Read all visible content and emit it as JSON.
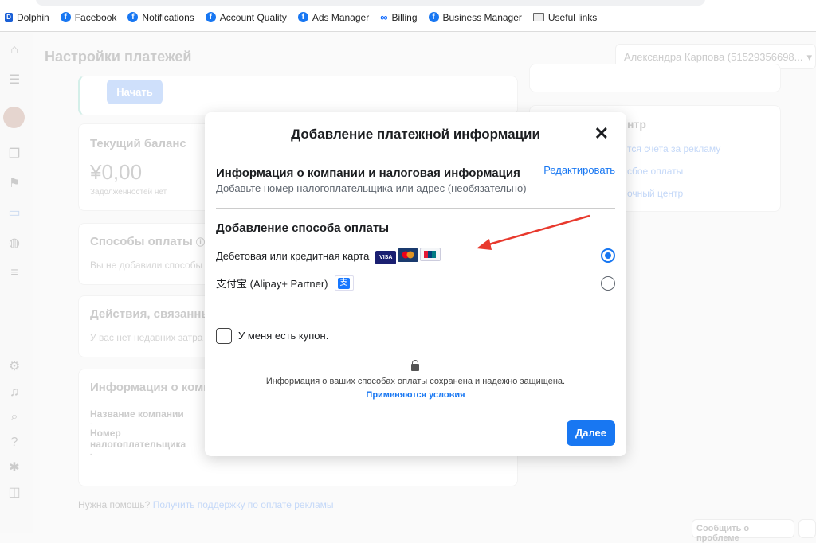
{
  "bookmarks": [
    {
      "label": "Dolphin",
      "icon": "dolphin-icon"
    },
    {
      "label": "Facebook",
      "icon": "facebook-icon"
    },
    {
      "label": "Notifications",
      "icon": "facebook-icon"
    },
    {
      "label": "Account Quality",
      "icon": "facebook-icon"
    },
    {
      "label": "Ads Manager",
      "icon": "facebook-icon"
    },
    {
      "label": "Billing",
      "icon": "meta-icon"
    },
    {
      "label": "Business Manager",
      "icon": "facebook-icon"
    },
    {
      "label": "Useful links",
      "icon": "folder-icon"
    }
  ],
  "page": {
    "title": "Настройки платежей",
    "account": "Александра Карпова (51529356698...",
    "start_button": "Начать",
    "balance_title": "Текущий баланс",
    "balance": "¥0,00",
    "balance_note": "Задолженностей нет.",
    "methods_title": "Способы оплаты",
    "methods_text": "Вы не добавили способы",
    "actions_title": "Действия, связанные",
    "actions_text": "У вас нет недавних затра",
    "company_title": "Информация о компа",
    "company_name_label": "Название компании",
    "company_name_value": "-",
    "tax_label_1": "Номер",
    "tax_label_2": "налогоплательщика",
    "tax_value": "-",
    "right_title": "нтр",
    "right_links": [
      "тся счета за рекламу",
      "сбое оплаты",
      "очный центр"
    ],
    "help_text": "Нужна помощь?",
    "help_link": "Получить поддержку по оплате рекламы",
    "report_button": "Сообщить о проблеме"
  },
  "modal": {
    "title": "Добавление платежной информации",
    "company_section_title": "Информация о компании и налоговая информация",
    "company_section_sub": "Добавьте номер налогоплательщика или адрес (необязательно)",
    "edit_link": "Редактировать",
    "payment_section_title": "Добавление способа оплаты",
    "options": [
      {
        "label": "Дебетовая или кредитная карта",
        "selected": true,
        "icons": [
          "visa-icon",
          "mastercard-icon",
          "unionpay-icon"
        ],
        "visa_text": "VISA"
      },
      {
        "label": "支付宝 (Alipay+ Partner)",
        "selected": false,
        "icons": [
          "alipay-icon"
        ],
        "alipay_glyph": "支"
      }
    ],
    "coupon_label": "У меня есть купон.",
    "coupon_checked": false,
    "secure_text": "Информация о ваших способах оплаты сохранена и надежно защищена.",
    "terms_link": "Применяются условия",
    "next_button": "Далее"
  },
  "colors": {
    "accent": "#1877f2",
    "annotation_arrow": "#e8392d"
  }
}
